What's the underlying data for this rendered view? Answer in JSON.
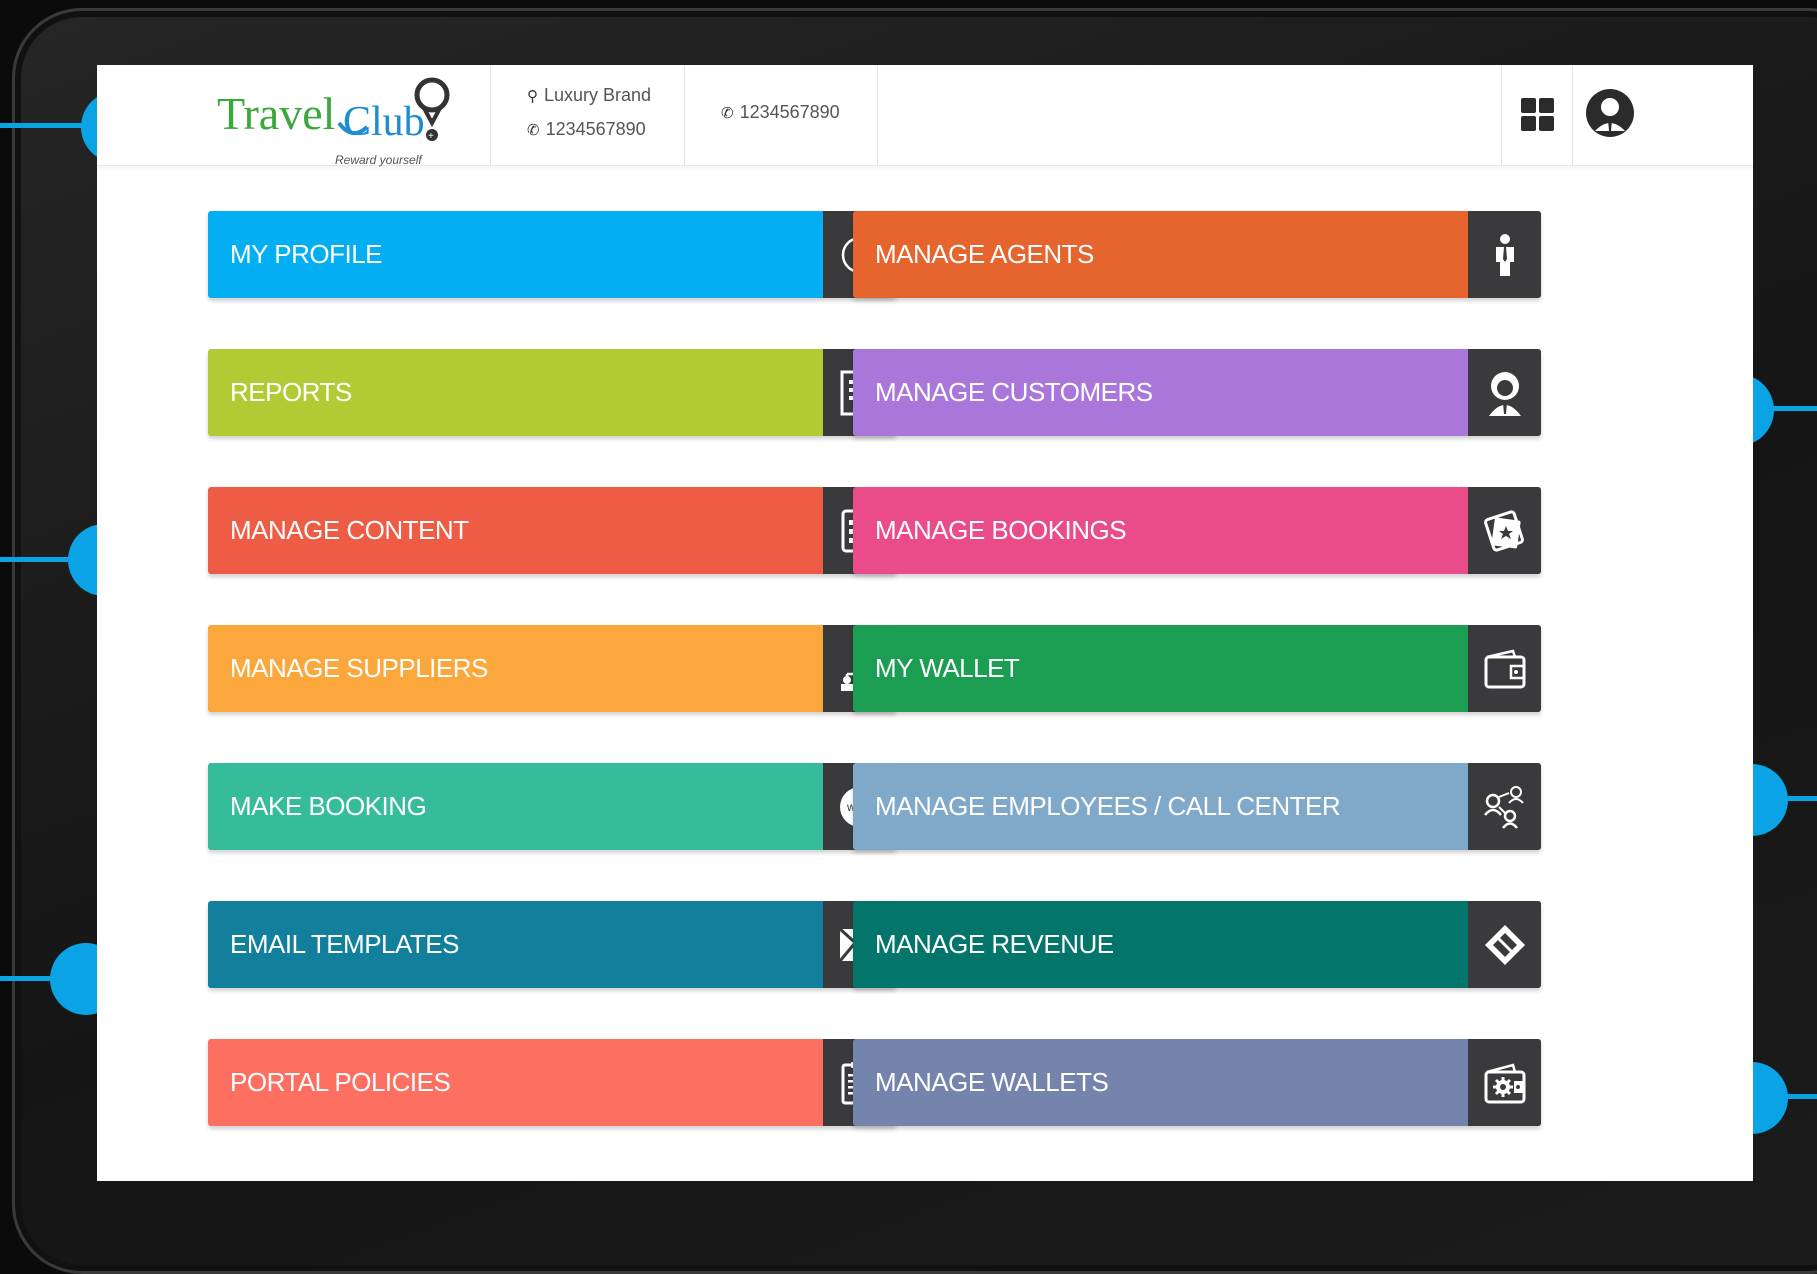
{
  "header": {
    "brand": {
      "name_part1": "Travel",
      "name_part2": "Club",
      "tagline": "Reward yourself"
    },
    "contact1": {
      "label": "Luxury Brand",
      "phone": "1234567890"
    },
    "contact2": {
      "phone": "1234567890"
    }
  },
  "tiles": [
    {
      "label": "MY PROFILE",
      "color": "#03aef2",
      "icon": "info-icon"
    },
    {
      "label": "MANAGE AGENTS",
      "color": "#e6652e",
      "icon": "agent-icon"
    },
    {
      "label": "REPORTS",
      "color": "#b2cb35",
      "icon": "report-icon"
    },
    {
      "label": "MANAGE CUSTOMERS",
      "color": "#a977d9",
      "icon": "customer-icon"
    },
    {
      "label": "MANAGE CONTENT",
      "color": "#ef5c45",
      "icon": "content-list-icon"
    },
    {
      "label": "MANAGE BOOKINGS",
      "color": "#ea4c89",
      "icon": "bookings-icon"
    },
    {
      "label": "MANAGE SUPPLIERS",
      "color": "#fca73b",
      "icon": "suppliers-hierarchy-icon"
    },
    {
      "label": "MY WALLET",
      "color": "#1c9e52",
      "icon": "wallet-icon"
    },
    {
      "label": "MAKE BOOKING",
      "color": "#37bc9b",
      "icon": "www-icon"
    },
    {
      "label": "MANAGE EMPLOYEES / CALL CENTER",
      "color": "#80a8c9",
      "icon": "employees-network-icon"
    },
    {
      "label": "EMAIL TEMPLATES",
      "color": "#127f9c",
      "icon": "envelope-icon"
    },
    {
      "label": "MANAGE REVENUE",
      "color": "#04756b",
      "icon": "ticket-icon"
    },
    {
      "label": "PORTAL POLICIES",
      "color": "#fd6f60",
      "icon": "clipboard-check-icon"
    },
    {
      "label": "MANAGE WALLETS",
      "color": "#7584ad",
      "icon": "wallet-settings-icon"
    }
  ],
  "colors": {
    "accent": "#0aa3e6",
    "logo_green": "#3aa83b",
    "logo_blue": "#1d8dd0",
    "icon_box": "#3a3a3c"
  }
}
